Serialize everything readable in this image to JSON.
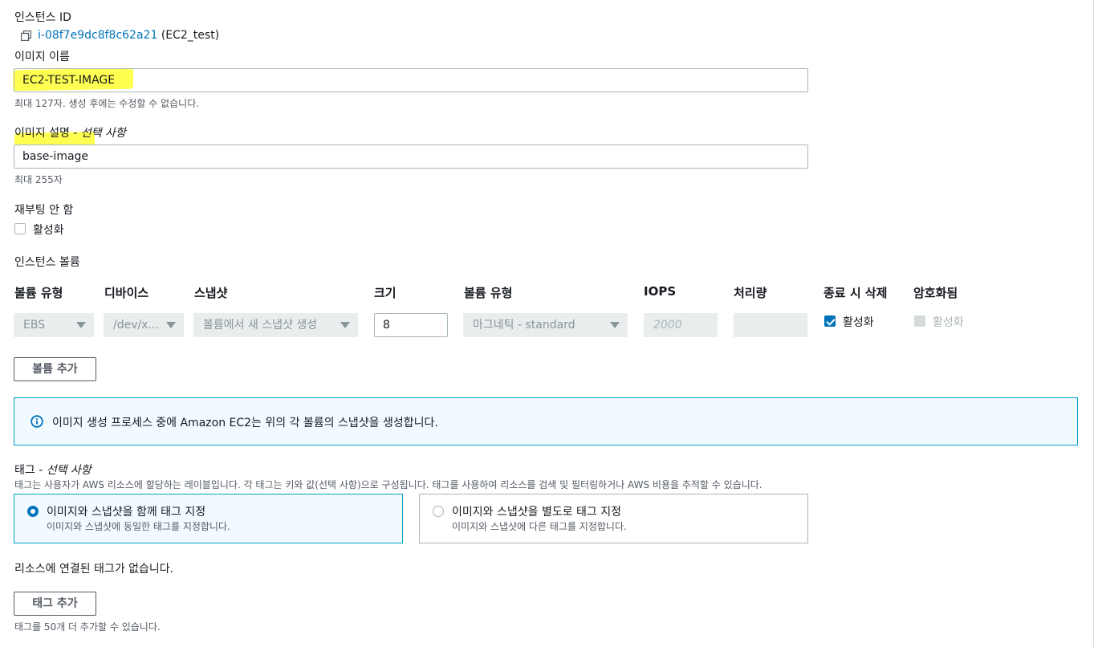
{
  "instance": {
    "label": "인스턴스 ID",
    "id_link": "i-08f7e9dc8f8c62a21",
    "name": "(EC2_test)"
  },
  "image_name": {
    "label": "이미지 이름",
    "value": "EC2-TEST-IMAGE",
    "hint": "최대 127자. 생성 후에는 수정할 수 없습니다."
  },
  "image_desc": {
    "label": "이미지 설명 - ",
    "optional": "선택 사항",
    "value": "base-image",
    "hint": "최대 255자"
  },
  "no_reboot": {
    "label": "재부팅 안 함",
    "checkbox_label": "활성화",
    "checked": false
  },
  "volumes": {
    "section_label": "인스턴스 볼륨",
    "headers": [
      "볼륨 유형",
      "디바이스",
      "스냅샷",
      "크기",
      "볼륨 유형",
      "IOPS",
      "처리량",
      "종료 시 삭제",
      "암호화됨"
    ],
    "row": {
      "type": "EBS",
      "device": "/dev/x...",
      "snapshot": "볼륨에서 새 스냅샷 생성",
      "size": "8",
      "volume_type": "마그네틱 - standard",
      "iops_placeholder": "2000",
      "throughput": "",
      "delete_on_term_label": "활성화",
      "encrypted_label": "활성화"
    },
    "add_button": "볼륨 추가"
  },
  "info_alert": {
    "text": "이미지 생성 프로세스 중에 Amazon EC2는 위의 각 볼륨의 스냅샷을 생성합니다."
  },
  "tags": {
    "label": "태그 - ",
    "optional": "선택 사항",
    "description": "태그는 사용자가 AWS 리소스에 할당하는 레이블입니다. 각 태그는 키와 값(선택 사항)으로 구성됩니다. 태그를 사용하여 리소스를 검색 및 필터링하거나 AWS 비용을 추적할 수 있습니다.",
    "option_together": {
      "title": "이미지와 스냅샷을 함께 태그 지정",
      "desc": "이미지와 스냅샷에 동일한 태그를 지정합니다."
    },
    "option_separate": {
      "title": "이미지와 스냅샷을 별도로 태그 지정",
      "desc": "이미지와 스냅샷에 다른 태그를 지정합니다."
    },
    "no_tags": "리소스에 연결된 태그가 없습니다.",
    "add_button": "태그 추가",
    "limit_hint": "태그를 50개 더 추가할 수 있습니다."
  },
  "colors": {
    "link": "#0073bb",
    "info_border": "#00a1c9",
    "highlight": "#ffff33"
  }
}
